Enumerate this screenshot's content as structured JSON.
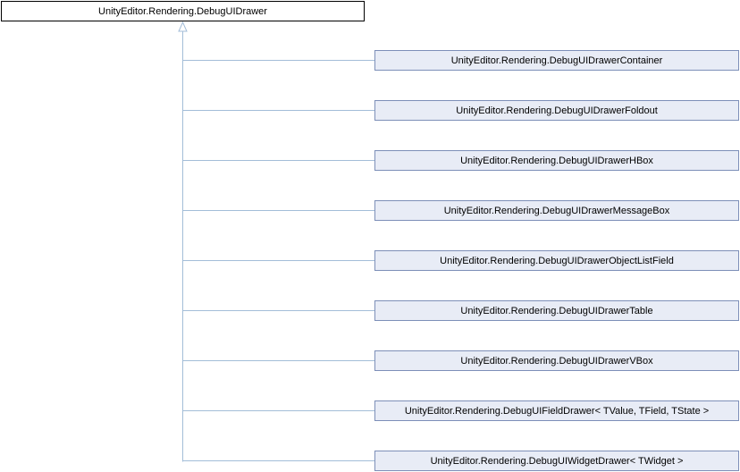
{
  "base_class": "UnityEditor.Rendering.DebugUIDrawer",
  "derived_classes": [
    "UnityEditor.Rendering.DebugUIDrawerContainer",
    "UnityEditor.Rendering.DebugUIDrawerFoldout",
    "UnityEditor.Rendering.DebugUIDrawerHBox",
    "UnityEditor.Rendering.DebugUIDrawerMessageBox",
    "UnityEditor.Rendering.DebugUIDrawerObjectListField",
    "UnityEditor.Rendering.DebugUIDrawerTable",
    "UnityEditor.Rendering.DebugUIDrawerVBox",
    "UnityEditor.Rendering.DebugUIFieldDrawer< TValue, TField, TState >",
    "UnityEditor.Rendering.DebugUIWidgetDrawer< TWidget >"
  ],
  "colors": {
    "edge": "#a3bdd8",
    "child_fill": "#e8ecf6",
    "child_border": "#7d8fb8",
    "root_border": "#000000"
  }
}
